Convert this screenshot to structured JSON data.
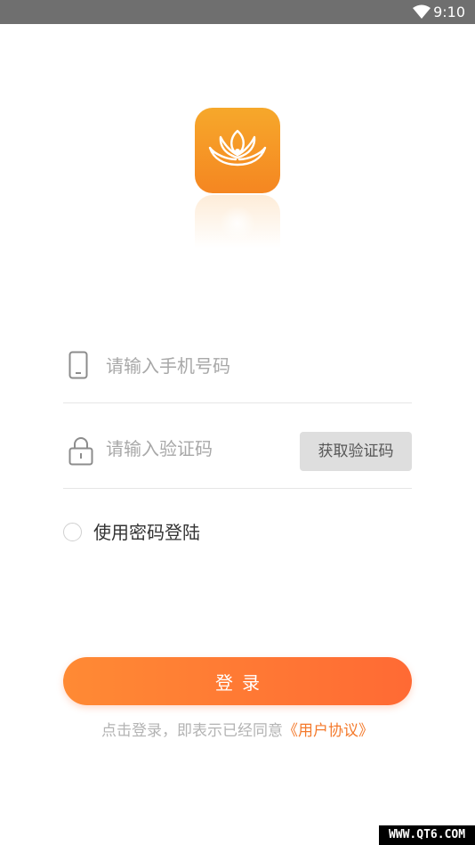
{
  "status_bar": {
    "time": "9:10"
  },
  "login": {
    "phone_placeholder": "请输入手机号码",
    "code_placeholder": "请输入验证码",
    "get_code_label": "获取验证码",
    "use_password_label": "使用密码登陆",
    "login_button_label": "登录",
    "agreement_prefix": "点击登录，即表示已经同意",
    "agreement_link": "《用户协议》"
  },
  "watermark": "WWW.QT6.COM",
  "colors": {
    "accent": "#ff7a33",
    "link": "#f47a2c",
    "logo_top": "#f6a82b",
    "logo_bottom": "#f58621",
    "status_bar": "#6f6f6f"
  },
  "icons": {
    "status": "wifi-icon",
    "logo": "lotus-icon",
    "phone_field": "phone-icon",
    "code_field": "lock-icon"
  }
}
